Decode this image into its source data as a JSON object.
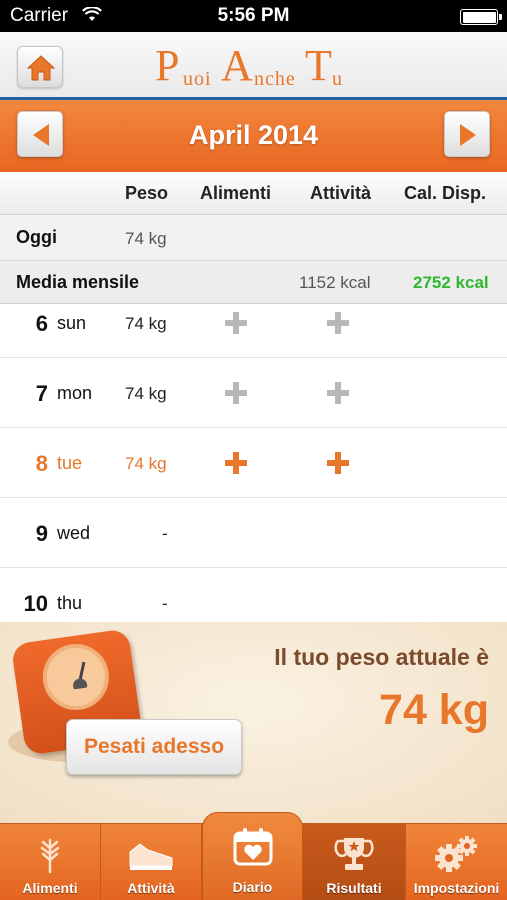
{
  "status_bar": {
    "carrier": "Carrier",
    "time": "5:56 PM"
  },
  "header": {
    "logo_letters": [
      "P",
      "uoi",
      "A",
      "nche",
      "T",
      "u"
    ],
    "logo_text": "PuoiAncheTu"
  },
  "month_nav": {
    "title": "April 2014"
  },
  "columns": {
    "peso": "Peso",
    "alimenti": "Alimenti",
    "attivita": "Attività",
    "cal_disp": "Cal. Disp."
  },
  "today_row": {
    "label": "Oggi",
    "peso": "74 kg"
  },
  "monthly_avg": {
    "label": "Media mensile",
    "attivita": "1152 kcal",
    "cal_disp": "2752 kcal"
  },
  "days": [
    {
      "num": "6",
      "name": "sun",
      "peso": "74 kg",
      "add_alimenti": true,
      "add_attivita": true,
      "today": false
    },
    {
      "num": "7",
      "name": "mon",
      "peso": "74 kg",
      "add_alimenti": true,
      "add_attivita": true,
      "today": false
    },
    {
      "num": "8",
      "name": "tue",
      "peso": "74 kg",
      "add_alimenti": true,
      "add_attivita": true,
      "today": true
    },
    {
      "num": "9",
      "name": "wed",
      "peso": "-",
      "add_alimenti": false,
      "add_attivita": false,
      "today": false
    },
    {
      "num": "10",
      "name": "thu",
      "peso": "-",
      "add_alimenti": false,
      "add_attivita": false,
      "today": false
    }
  ],
  "weight_panel": {
    "caption": "Il tuo peso attuale è",
    "value": "74 kg",
    "button": "Pesati adesso"
  },
  "tabs": [
    {
      "label": "Alimenti",
      "icon": "wheat-icon",
      "selected": false
    },
    {
      "label": "Attività",
      "icon": "sneaker-icon",
      "selected": false
    },
    {
      "label": "Diario",
      "icon": "calendar-heart-icon",
      "selected": false
    },
    {
      "label": "Risultati",
      "icon": "trophy-icon",
      "selected": true
    },
    {
      "label": "Impostazioni",
      "icon": "gears-icon",
      "selected": false
    }
  ],
  "colors": {
    "accent": "#e8772c",
    "green": "#2eb82e",
    "header_rule": "#1e5ea8"
  }
}
